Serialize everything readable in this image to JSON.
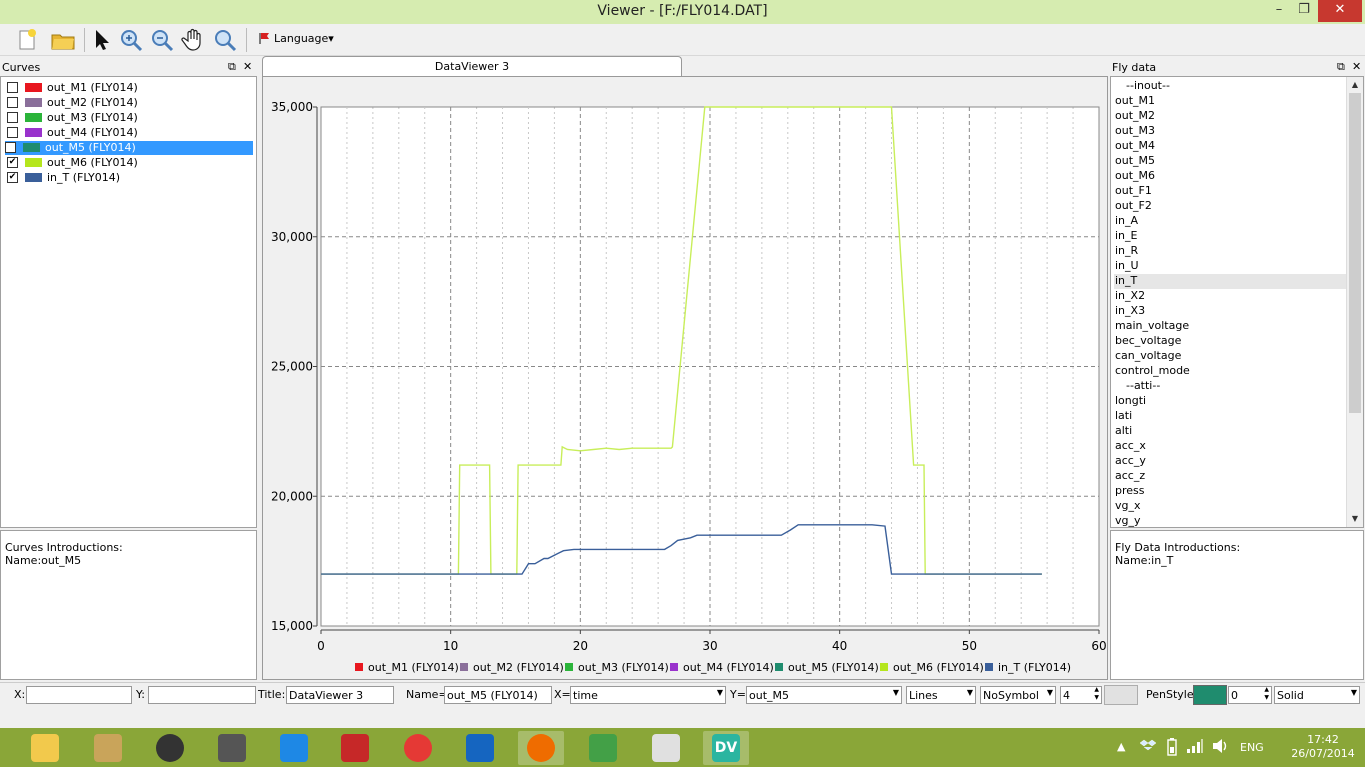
{
  "window": {
    "title": "Viewer - [F:/FLY014.DAT]",
    "min_glyph": "–",
    "max_glyph": "❐",
    "close_glyph": "✕"
  },
  "toolbar": {
    "buttons": [
      "new-file-icon",
      "open-folder-icon",
      "pointer-icon",
      "zoom-in-icon",
      "zoom-out-icon",
      "pan-hand-icon",
      "zoom-fit-icon"
    ],
    "language_label": "Language",
    "language_arrow": "▾"
  },
  "curves_panel": {
    "title": "Curves",
    "float_glyph": "⧉",
    "close_glyph": "✕",
    "items": [
      {
        "label": "out_M1 (FLY014)",
        "color": "#e8171f",
        "checked": false,
        "check_mark": ""
      },
      {
        "label": "out_M2 (FLY014)",
        "color": "#8a6f9a",
        "checked": false,
        "check_mark": ""
      },
      {
        "label": "out_M3 (FLY014)",
        "color": "#2bb43a",
        "checked": false,
        "check_mark": ""
      },
      {
        "label": "out_M4 (FLY014)",
        "color": "#9932cc",
        "checked": false,
        "check_mark": ""
      },
      {
        "label": "out_M5 (FLY014)",
        "color": "#1f8c6e",
        "checked": false,
        "check_mark": "",
        "selected": true
      },
      {
        "label": "out_M6 (FLY014)",
        "color": "#b5e61d",
        "checked": true,
        "check_mark": "✔"
      },
      {
        "label": "in_T (FLY014)",
        "color": "#3a5f9a",
        "checked": true,
        "check_mark": "✔"
      }
    ],
    "intro_heading": "Curves Introductions:",
    "intro_name": "Name:out_M5"
  },
  "dataviewer": {
    "tab_label": "DataViewer 3"
  },
  "chart_data": {
    "type": "line",
    "title": "",
    "xlabel": "",
    "ylabel": "",
    "xlim": [
      0,
      60
    ],
    "ylim": [
      15000,
      35000
    ],
    "x_ticks": [
      0,
      10,
      20,
      30,
      40,
      50,
      60
    ],
    "y_ticks": [
      15000,
      20000,
      25000,
      30000,
      35000
    ],
    "x_tick_labels": [
      "0",
      "10",
      "20",
      "30",
      "40",
      "50",
      "60"
    ],
    "y_tick_labels": [
      "15,000",
      "20,000",
      "25,000",
      "30,000",
      "35,000"
    ],
    "grid": true,
    "legend_placement": "bottom",
    "legend": [
      {
        "name": "out_M1 (FLY014)",
        "color": "#e8171f"
      },
      {
        "name": "out_M2 (FLY014)",
        "color": "#8a6f9a"
      },
      {
        "name": "out_M3 (FLY014)",
        "color": "#2bb43a"
      },
      {
        "name": "out_M4 (FLY014)",
        "color": "#9932cc"
      },
      {
        "name": "out_M5 (FLY014)",
        "color": "#1f8c6e"
      },
      {
        "name": "out_M6 (FLY014)",
        "color": "#b5e61d"
      },
      {
        "name": "in_T (FLY014)",
        "color": "#3a5f9a"
      }
    ],
    "series": [
      {
        "name": "out_M6 (FLY014)",
        "color": "#c8ee5a",
        "x": [
          0,
          10.6,
          10.7,
          13.0,
          13.1,
          15.1,
          15.2,
          18.5,
          18.6,
          19,
          20,
          21,
          22,
          23,
          24,
          25,
          26,
          27.0,
          27.1,
          29.6,
          29.7,
          43.9,
          44.0,
          45.7,
          45.8,
          46.5,
          46.6,
          55.6
        ],
        "y": [
          17000,
          17000,
          21200,
          21200,
          17000,
          17000,
          21200,
          21200,
          21900,
          21800,
          21750,
          21800,
          21850,
          21800,
          21850,
          21850,
          21850,
          21850,
          21900,
          35000,
          35000,
          35000,
          35000,
          21200,
          21200,
          21200,
          17000,
          17000
        ]
      },
      {
        "name": "in_T (FLY014)",
        "color": "#3a5f9a",
        "x": [
          0,
          15.5,
          16.0,
          16.5,
          17.2,
          17.5,
          18.3,
          18.7,
          19.5,
          26.5,
          27.0,
          27.5,
          28.5,
          29.0,
          35.5,
          36.2,
          36.8,
          42.5,
          43.5,
          44.0,
          44.5,
          55.6
        ],
        "y": [
          17000,
          17000,
          17400,
          17400,
          17600,
          17600,
          17800,
          17900,
          17950,
          17950,
          18100,
          18300,
          18400,
          18500,
          18500,
          18700,
          18900,
          18900,
          18850,
          17000,
          17000,
          17000
        ]
      }
    ]
  },
  "flydata_panel": {
    "title": "Fly data",
    "float_glyph": "⧉",
    "close_glyph": "✕",
    "items": [
      "--inout--",
      "out_M1",
      "out_M2",
      "out_M3",
      "out_M4",
      "out_M5",
      "out_M6",
      "out_F1",
      "out_F2",
      "in_A",
      "in_E",
      "in_R",
      "in_U",
      "in_T",
      "in_X2",
      "in_X3",
      "main_voltage",
      "bec_voltage",
      "can_voltage",
      "control_mode",
      "--atti--",
      "longti",
      "lati",
      "alti",
      "acc_x",
      "acc_y",
      "acc_z",
      "press",
      "vg_x",
      "vg_y"
    ],
    "selected_index": 13,
    "scroll_up_glyph": "▲",
    "scroll_down_glyph": "▼",
    "intro_heading": "Fly Data Introductions:",
    "intro_name": "Name:in_T"
  },
  "statusbar": {
    "x_label": "X:",
    "x_value": "",
    "y_label": "Y:",
    "y_value": "",
    "title_label": "Title:",
    "title_value": "DataViewer 3",
    "name_label": "Name=",
    "name_value": "out_M5 (FLY014)",
    "xsel_label": "X=",
    "xsel_value": "time",
    "ysel_label": "Y=",
    "ysel_value": "out_M5",
    "style_value": "Lines",
    "symbol_value": "NoSymbol",
    "width_value": "4",
    "penstyle_label": "PenStyle:",
    "pen_color": "#1f8c6e",
    "pen_num_value": "0",
    "pen_style_value": "Solid",
    "combo_arrow": "▼",
    "spin_up": "▲",
    "spin_down": "▼"
  },
  "taskbar": {
    "apps": [
      "file-explorer-icon",
      "disk-utility-icon",
      "speaker-app-icon",
      "document-icon",
      "internet-explorer-icon",
      "power-app-icon",
      "chrome-icon",
      "system-app-icon",
      "firefox-icon",
      "icq-flower-icon",
      "notepad-icon",
      "dataviewer-app-icon"
    ],
    "dv_label": "DV",
    "tray_language": "ENG",
    "tray_up_glyph": "▲",
    "time": "17:42",
    "date": "26/07/2014"
  }
}
